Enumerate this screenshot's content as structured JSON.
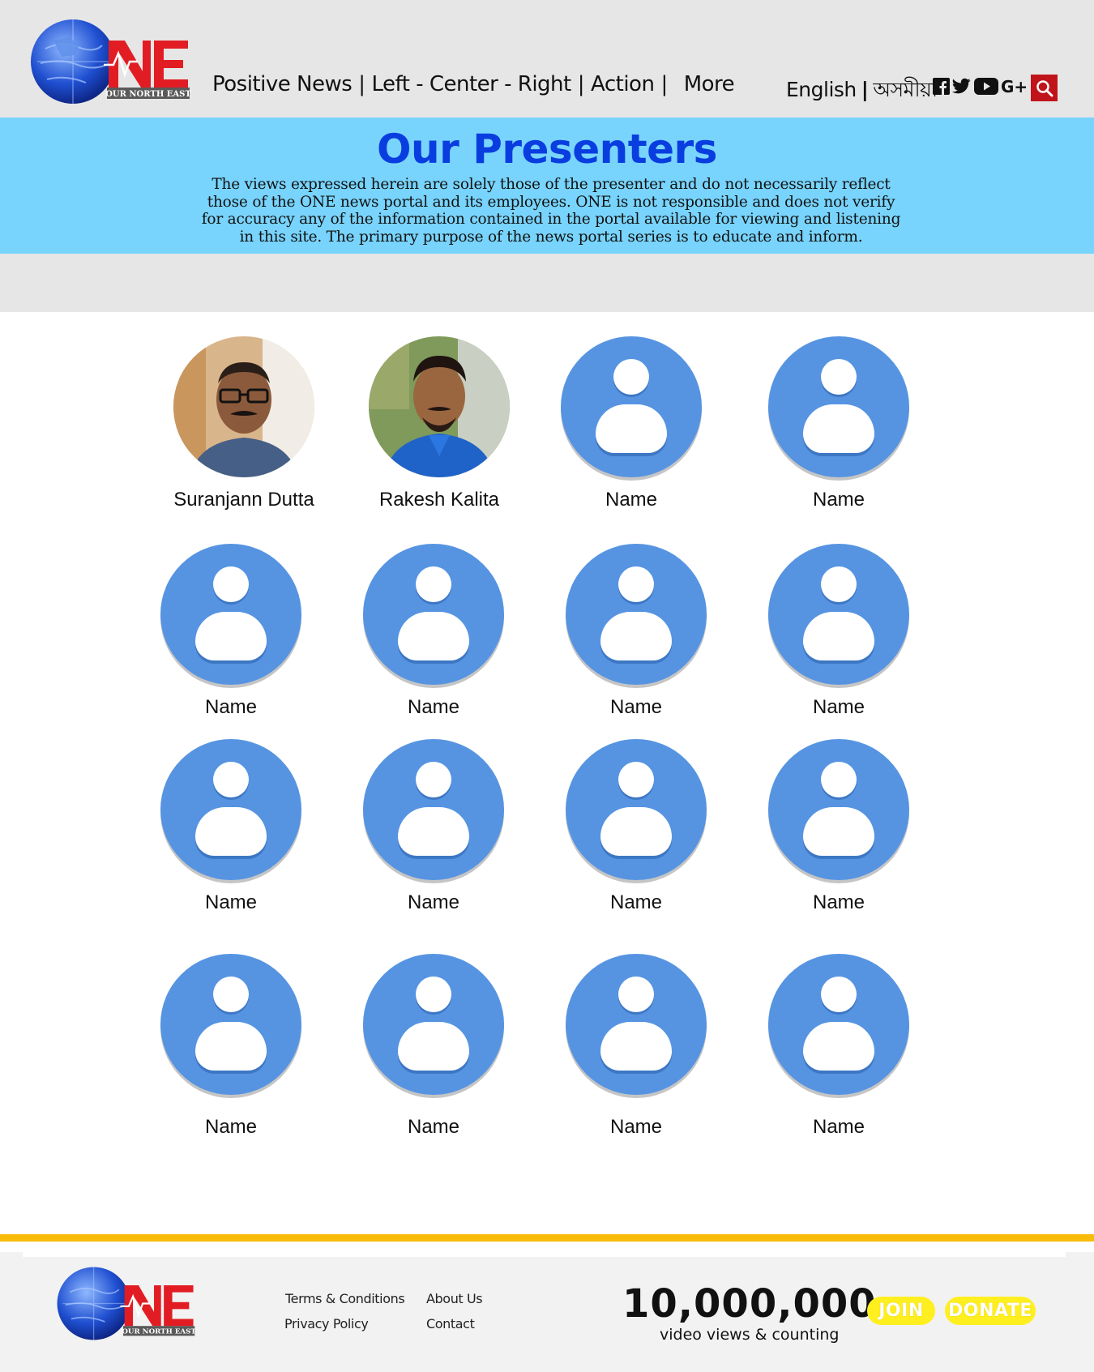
{
  "header": {
    "logo_alt": "ONE Our North East",
    "logo_text": "ONE",
    "logo_tag": "OUR NORTH EAST",
    "nav": [
      "Positive News",
      "Left - Center - Right",
      "Action",
      "More"
    ],
    "separator": "|",
    "languages": [
      "English",
      "অসমীয়া"
    ],
    "social_icons": [
      "facebook-icon",
      "twitter-icon",
      "youtube-icon",
      "google-plus-icon"
    ],
    "search_icon": "search-icon"
  },
  "banner": {
    "title": "Our Presenters",
    "disclaimer": "The views expressed herein are solely those of the presenter and do not necessarily reflect those of the ONE news portal and its employees. ONE is not responsible and does not verify for accuracy any of the information contained in the portal available for viewing and listening in this site. The primary purpose of the news portal series is to educate and inform."
  },
  "presenters": [
    {
      "name": "Suranjann Dutta",
      "photo": true
    },
    {
      "name": "Rakesh Kalita",
      "photo": true
    },
    {
      "name": "Name",
      "photo": false
    },
    {
      "name": "Name",
      "photo": false
    },
    {
      "name": "Name",
      "photo": false
    },
    {
      "name": "Name",
      "photo": false
    },
    {
      "name": "Name",
      "photo": false
    },
    {
      "name": "Name",
      "photo": false
    },
    {
      "name": "Name",
      "photo": false
    },
    {
      "name": "Name",
      "photo": false
    },
    {
      "name": "Name",
      "photo": false
    },
    {
      "name": "Name",
      "photo": false
    },
    {
      "name": "Name",
      "photo": false
    },
    {
      "name": "Name",
      "photo": false
    },
    {
      "name": "Name",
      "photo": false
    },
    {
      "name": "Name",
      "photo": false
    }
  ],
  "footer": {
    "links": [
      "Terms & Conditions",
      "About Us",
      "Privacy Policy",
      "Contact"
    ],
    "count": "10,000,000",
    "count_caption": "video views & counting",
    "join_label": "JOIN",
    "donate_label": "DONATE"
  },
  "colors": {
    "banner_bg": "#78d4fc",
    "title_blue": "#0a3de0",
    "avatar_blue": "#5694e2",
    "footer_rule": "#f9bb0a",
    "pill_yellow": "#ffef1f",
    "search_red": "#c0141a"
  }
}
